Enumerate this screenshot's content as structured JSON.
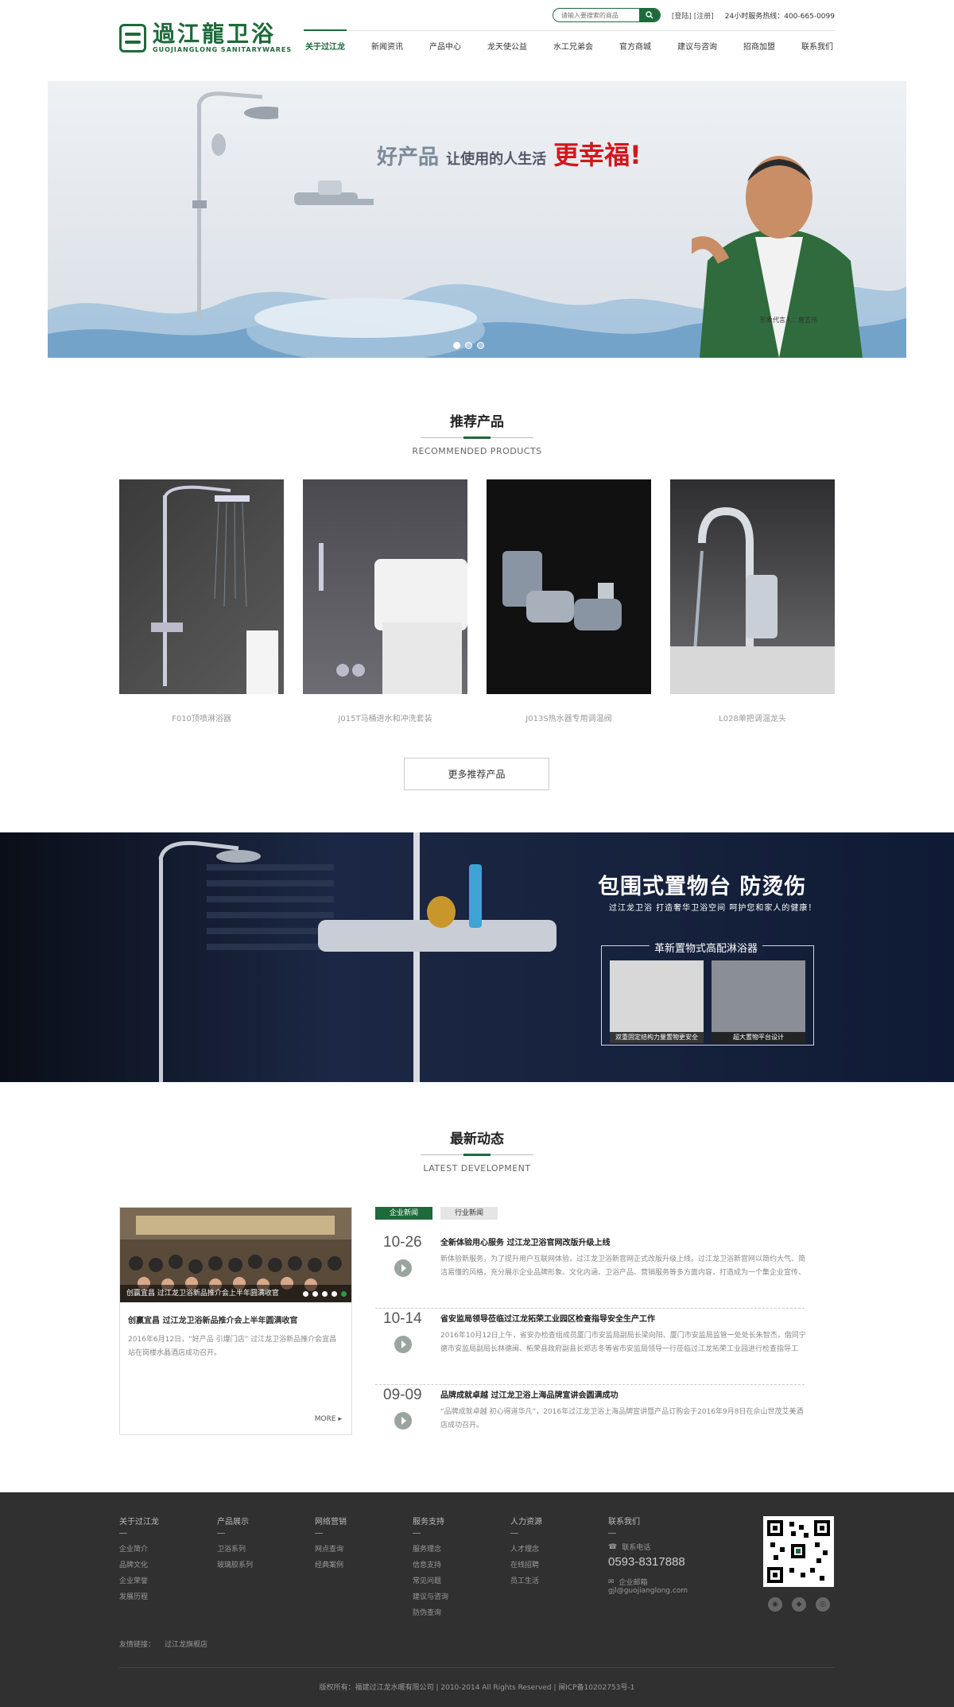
{
  "header": {
    "logo_cn": "過江龍卫浴",
    "logo_en": "GUOJIANGLONG SANITARYWARES",
    "search_placeholder": "请输入要搜索的商品",
    "login": "[登陆]",
    "register": "[注册]",
    "hotline": "24小时服务热线：400-665-0099",
    "nav": [
      "关于过江龙",
      "新闻资讯",
      "产品中心",
      "龙天使公益",
      "水工兄弟会",
      "官方商城",
      "建议与咨询",
      "招商加盟",
      "联系我们"
    ]
  },
  "banner": {
    "slogan_a": "好产品",
    "slogan_b": "让使用的人生活",
    "slogan_c": "更幸福!",
    "spokesman": "形象代言人：曾志伟",
    "slide_count": 3,
    "active_slide": 1
  },
  "recommend": {
    "title_cn": "推荐产品",
    "title_en": "RECOMMENDED PRODUCTS",
    "products": [
      {
        "name": "F010顶喷淋浴器"
      },
      {
        "name": "J015T马桶进水和冲洗套装"
      },
      {
        "name": "J013S热水器专用调温阀"
      },
      {
        "name": "L028单把调温龙头"
      }
    ],
    "more_label": "更多推荐产品"
  },
  "mid_banner": {
    "title": "包围式置物台 防烫伤",
    "subtitle": "过江龙卫浴   打造奢华卫浴空间   呵护您和家人的健康！",
    "box_title": "革新置物式高配淋浴器",
    "thumb1": "双重固定结构力量置物更安全",
    "thumb2": "超大置物平台设计"
  },
  "news": {
    "title_cn": "最新动态",
    "title_en": "LATEST DEVELOPMENT",
    "feature": {
      "caption": "创赢宜昌 过江龙卫浴新品推介会上半年圆满收官",
      "title": "创赢宜昌 过江龙卫浴新品推介会上半年圆满收官",
      "text": "2016年6月12日，“好产品 引爆门店” 过江龙卫浴新品推介会宜昌站在岗楼水晶酒店成功召开。",
      "more": "MORE"
    },
    "tabs": [
      "企业新闻",
      "行业新闻"
    ],
    "items": [
      {
        "date": "10-26",
        "title": "全新体验用心服务 过江龙卫浴官网改版升级上线",
        "text": "新体验新服务，为了提升用户互联网体验，过江龙卫浴新官网正式改版升级上线。过江龙卫浴新官网以简约大气、简洁易懂的风格，充分展示企业品牌形象、文化内涵、卫浴产品、营销服务等多方面内容，打造成为一个集企业宣传、"
      },
      {
        "date": "10-14",
        "title": "省安监局领导莅临过江龙拓荣工业园区检查指导安全生产工作",
        "text": "2016年10月12日上午，省安办检查组成员厦门市安监局副局长梁向阳、厦门市安监局监管一处处长朱智杰，偕同宁德市安监局副局长林德闽、柘荣县政府副县长郑志冬等省市安监局领导一行莅临过江龙拓荣工业园进行检查指导工"
      },
      {
        "date": "09-09",
        "title": "品牌成就卓越 过江龙卫浴上海品牌宣讲会圆满成功",
        "text": "“品牌成就卓越 初心得道华凡”，2016年过江龙卫浴上海品牌宣讲暨产品订购会于2016年9月8日在佘山世茂艾美酒店成功召开。"
      }
    ]
  },
  "footer": {
    "cols": [
      {
        "head": "关于过江龙",
        "links": [
          "企业简介",
          "品牌文化",
          "企业荣誉",
          "发展历程"
        ]
      },
      {
        "head": "产品展示",
        "links": [
          "卫浴系列",
          "玻璃胶系列"
        ]
      },
      {
        "head": "网络营销",
        "links": [
          "网点查询",
          "经典案例"
        ]
      },
      {
        "head": "服务支持",
        "links": [
          "服务理念",
          "信息支持",
          "常见问题",
          "建议与咨询",
          "防伪查询"
        ]
      },
      {
        "head": "人力资源",
        "links": [
          "人才理念",
          "在线招聘",
          "员工生活"
        ]
      }
    ],
    "contact_head": "联系我们",
    "phone_label": "联系电话",
    "phone": "0593-8317888",
    "mail_label": "企业邮箱",
    "mail": "gjl@guojianglong.com",
    "friends_label": "友情链接：",
    "friends_link": "过江龙旗舰店",
    "copyright": "版权所有：福建过江龙水暖有限公司 | 2010-2014 All Rights Reserved | 闽ICP备10202753号-1"
  }
}
